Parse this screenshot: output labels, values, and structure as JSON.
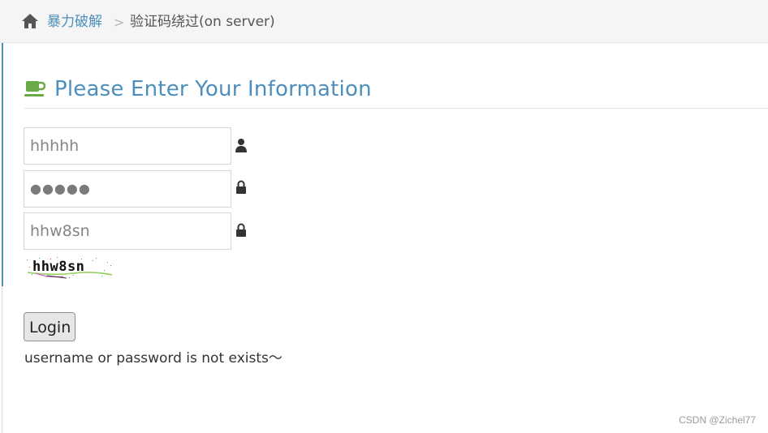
{
  "breadcrumbs": {
    "home_label": "暴力破解",
    "separator": ">",
    "current": "验证码绕过(on server)"
  },
  "page": {
    "title": "Please Enter Your Information"
  },
  "form": {
    "username_value": "hhhhh",
    "password_value": "●●●●●",
    "vcode_value": "hhw8sn",
    "captcha_text": "hhw8sn",
    "login_label": "Login"
  },
  "message": {
    "error": "username or password is not exists～"
  },
  "watermark": "CSDN @Zichel77",
  "colors": {
    "accent": "#4c8fbd",
    "coffee_icon": "#69aa46"
  },
  "icons": {
    "home": "home-icon",
    "title": "coffee-icon",
    "username": "user-icon",
    "password": "lock-icon",
    "vcode": "lock-icon"
  }
}
